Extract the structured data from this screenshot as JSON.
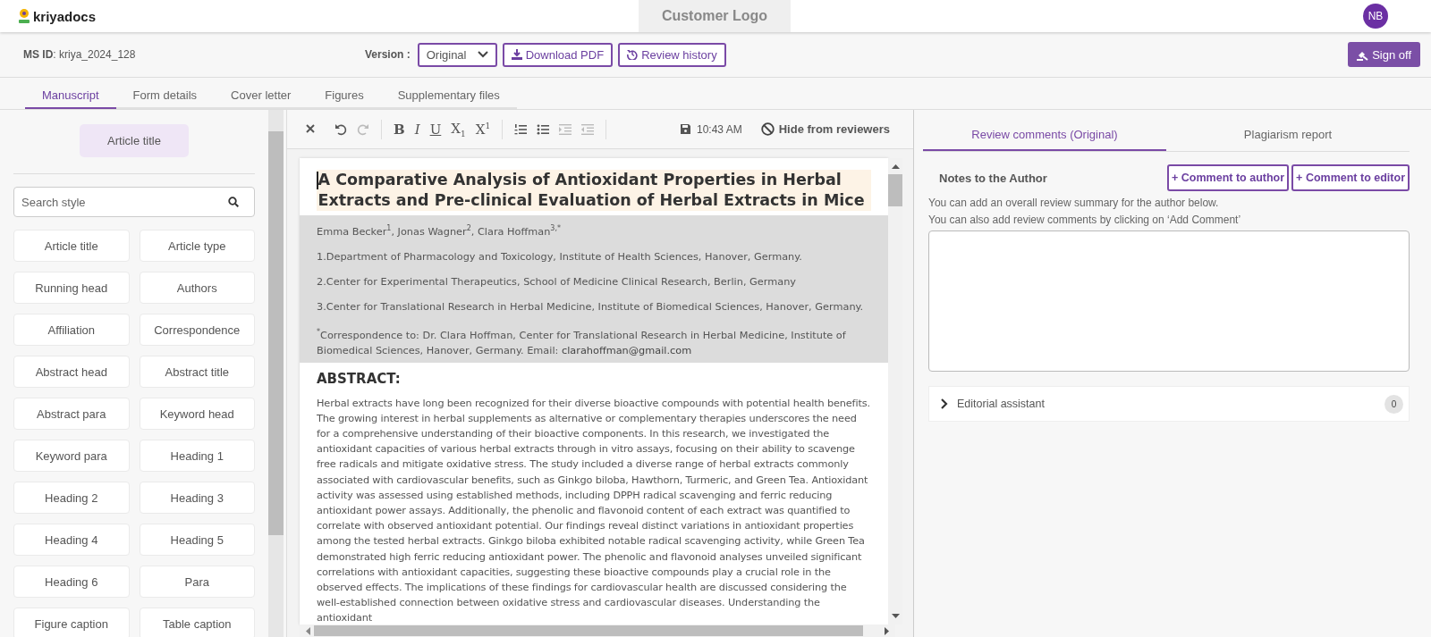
{
  "header": {
    "brand": "kriyadocs",
    "customer_logo": "Customer Logo",
    "avatar": "NB"
  },
  "infobar": {
    "ms_id_label": "MS ID",
    "ms_id": ": kriya_2024_128",
    "version_label": "Version :",
    "version": "Original",
    "download": "Download PDF",
    "history": "Review history",
    "sign_off": "Sign off"
  },
  "tabs": [
    {
      "label": "Manuscript",
      "selected": true
    },
    {
      "label": "Form details",
      "selected": false
    },
    {
      "label": "Cover letter",
      "selected": false
    },
    {
      "label": "Figures",
      "selected": false
    },
    {
      "label": "Supplementary files",
      "selected": false
    }
  ],
  "style_panel": {
    "current_style": "Article title",
    "search": {
      "placeholder": "Search style"
    },
    "styles": [
      "Article title",
      "Article type",
      "Running head",
      "Authors",
      "Affiliation",
      "Correspondence",
      "Abstract head",
      "Abstract title",
      "Abstract para",
      "Keyword head",
      "Keyword para",
      "Heading 1",
      "Heading 2",
      "Heading 3",
      "Heading 4",
      "Heading 5",
      "Heading 6",
      "Para",
      "Figure caption",
      "Table caption"
    ]
  },
  "toolbar": {
    "tools": [
      {
        "kind": "close",
        "disabled": false
      },
      {
        "kind": "undo",
        "disabled": false
      },
      {
        "kind": "redo",
        "disabled": true
      },
      {
        "kind": "sep"
      },
      {
        "kind": "bold",
        "label": "B",
        "disabled": false
      },
      {
        "kind": "italic",
        "label": "I",
        "disabled": false
      },
      {
        "kind": "underline",
        "label": "U",
        "disabled": false
      },
      {
        "kind": "subscript",
        "label": "X$_{1}$",
        "disabled": false
      },
      {
        "kind": "superscript",
        "label": "X$^{1}$",
        "disabled": false
      },
      {
        "kind": "sep"
      },
      {
        "kind": "ordered",
        "disabled": false
      },
      {
        "kind": "bullets",
        "disabled": false
      },
      {
        "kind": "indent",
        "disabled": true
      },
      {
        "kind": "outdent",
        "disabled": true
      },
      {
        "kind": "sep"
      }
    ],
    "saved_time": "10:43 AM",
    "hide": "Hide from reviewers"
  },
  "document": {
    "title": "A Comparative Analysis of Antioxidant Properties in Herbal Extracts and Pre-clinical Evaluation of Herbal Extracts in Mice",
    "authors": "Emma Becker$^{1}$, Jonas Wagner$^{2}$, Clara Hoffman$^{3,*}$",
    "affiliations": [
      "1.Department of Pharmacology and Toxicology, Institute of Health Sciences, Hanover, Germany.",
      "2.Center for Experimental Therapeutics, School of Medicine Clinical Research, Berlin, Germany",
      "3.Center for Translational Research in Herbal Medicine, Institute of Biomedical Sciences, Hanover, Germany."
    ],
    "correspondence": "$^{*}$Correspondence to: Dr. Clara Hoffman, Center for Translational Research in Herbal Medicine, Institute of Biomedical Sciences, Hanover, Germany. Email: ",
    "email": "clarahoffman@gmail.com",
    "abstract_head": "ABSTRACT:",
    "abstract": "Herbal extracts have long been recognized for their diverse bioactive compounds with potential health benefits. The growing interest in herbal supplements as alternative or complementary therapies underscores the need for a comprehensive understanding of their bioactive components. In this research, we investigated the antioxidant capacities of various herbal extracts through in vitro assays, focusing on their ability to scavenge free radicals and mitigate oxidative stress. The study included a diverse range of herbal extracts commonly associated with cardiovascular benefits, such as Ginkgo biloba, Hawthorn, Turmeric, and Green Tea. Antioxidant activity was assessed using established methods, including DPPH radical scavenging and ferric reducing antioxidant power assays. Additionally, the phenolic and flavonoid content of each extract was quantified to correlate with observed antioxidant potential. Our findings reveal distinct variations in antioxidant properties among the tested herbal extracts. Ginkgo biloba exhibited notable radical scavenging activity, while Green Tea demonstrated high ferric reducing antioxidant power. The phenolic and flavonoid analyses unveiled significant correlations with antioxidant capacities, suggesting these bioactive compounds play a crucial role in the observed effects. The implications of these findings for cardiovascular health are discussed considering the well-established connection between oxidative stress and cardiovascular diseases. Understanding the antioxidant"
  },
  "review": {
    "tabs": [
      {
        "label": "Review comments (Original)",
        "selected": true
      },
      {
        "label": "Plagiarism report",
        "selected": false
      }
    ],
    "notes_heading": "Notes to the Author",
    "comment_author": "+ Comment to author",
    "comment_editor": "+ Comment to editor",
    "hints": [
      "You can add an overall review summary for the author below.",
      "You can also add review comments by clicking on ‘Add Comment’"
    ],
    "assistant": {
      "label": "Editorial assistant",
      "count": "0",
      "expanded": false
    }
  }
}
